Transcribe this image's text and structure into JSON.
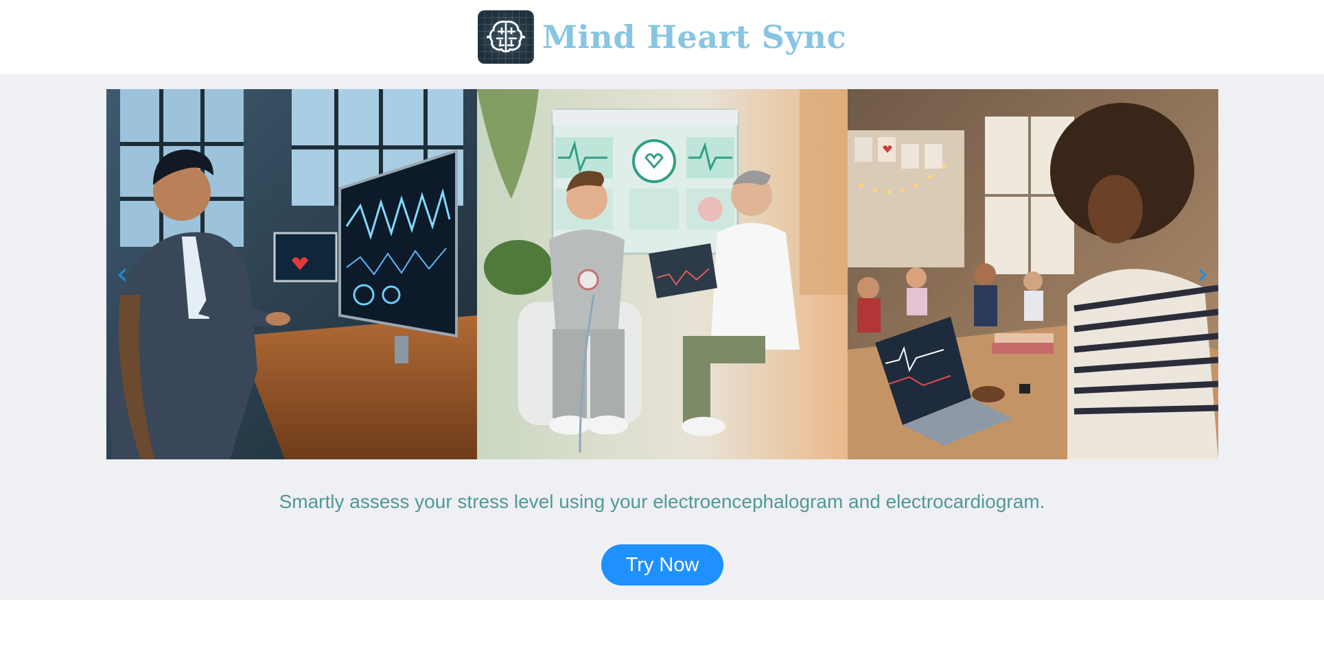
{
  "header": {
    "title": "Mind Heart Sync",
    "logo_icon": "brain-grid-icon"
  },
  "carousel": {
    "slides": [
      {
        "name": "analyst-workstation-slide"
      },
      {
        "name": "doctor-patient-slide"
      },
      {
        "name": "classroom-laptop-slide"
      }
    ],
    "prev_icon": "chevron-left-icon",
    "next_icon": "chevron-right-icon",
    "prev_glyph": "‹",
    "next_glyph": "›"
  },
  "main": {
    "tagline": "Smartly assess your stress level using your electroencephalogram and electrocardiogram.",
    "cta_label": "Try Now"
  },
  "colors": {
    "brand_title": "#86c5e3",
    "accent": "#1e90ff",
    "tagline": "#4f9996",
    "stage_bg": "#eff0f4"
  }
}
